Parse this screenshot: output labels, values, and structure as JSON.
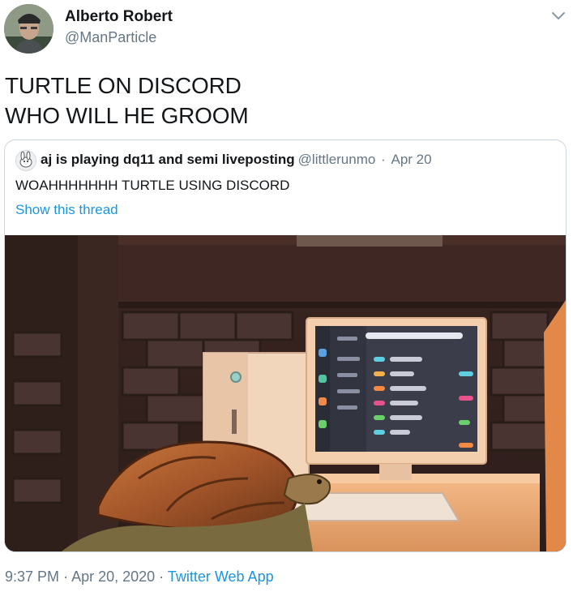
{
  "author": {
    "name": "Alberto Robert",
    "handle": "@ManParticle"
  },
  "tweet": {
    "lines": [
      "TURTLE ON DISCORD",
      "WHO WILL HE GROOM"
    ]
  },
  "quoted": {
    "name": "aj is playing dq11 and semi liveposting",
    "handle": "@littlerunmo",
    "separator": "·",
    "date": "Apr 20",
    "text": "WOAHHHHHHH TURTLE USING DISCORD",
    "show_thread": "Show this thread"
  },
  "footer": {
    "time": "9:37 PM",
    "separator": "·",
    "date": "Apr 20, 2020",
    "source": "Twitter Web App"
  },
  "colors": {
    "link": "#1b95e0",
    "secondary": "#657786",
    "border": "#ccd6dd"
  },
  "icons": {
    "more": "chevron-down-icon"
  }
}
